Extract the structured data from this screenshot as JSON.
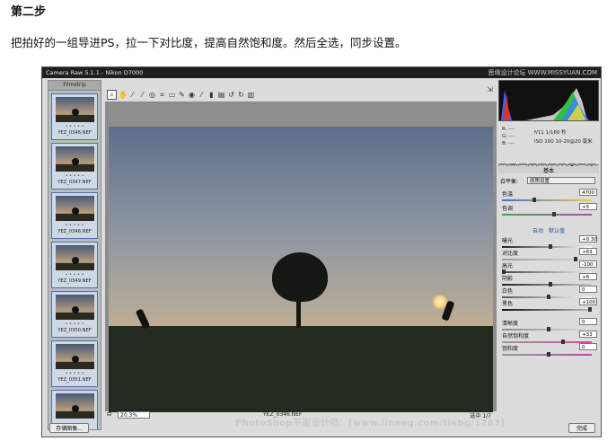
{
  "heading": "第二步",
  "intro": "把拍好的一组导进PS，拉一下对比度，提高自然饱和度。然后全选，同步设置。",
  "app": {
    "title": "Camera Raw 5.1.1 - Nikon D7000",
    "top_watermark": "思缘设计论坛 WWW.MISSYUAN.COM",
    "filmstrip_label": "Filmstrip",
    "thumb_dots": "• • • • •",
    "thumbnails": [
      "YEZ_0346.NEF",
      "YEZ_0347.NEF",
      "YEZ_0348.NEF",
      "YEZ_0349.NEF",
      "YEZ_0350.NEF",
      "YEZ_0351.NEF"
    ],
    "zoom": "20.3%",
    "current_file": "YEZ_0346.NEF",
    "pager": "选中 1/7",
    "info": {
      "r": "R: ---",
      "g": "G: ---",
      "b": "B: ---",
      "exposure": "f/11   1/160 秒",
      "iso": "ISO 100   10-20@20 毫米"
    },
    "panel_title": "基本",
    "wb_label": "白平衡:",
    "wb_value": "原照设置",
    "auto": "自动",
    "default": "默认值",
    "sliders": [
      {
        "label": "色温",
        "value": "4700"
      },
      {
        "label": "色调",
        "value": "+5"
      },
      {
        "label": "曝光",
        "value": "+0.30"
      },
      {
        "label": "对比度",
        "value": "+63"
      },
      {
        "label": "高光",
        "value": "-100"
      },
      {
        "label": "阴影",
        "value": "+6"
      },
      {
        "label": "白色",
        "value": "0"
      },
      {
        "label": "黑色",
        "value": "+100"
      },
      {
        "label": "清晰度",
        "value": "0"
      },
      {
        "label": "自然饱和度",
        "value": "+33"
      },
      {
        "label": "饱和度",
        "value": "0"
      }
    ],
    "save_button": "存储图像...",
    "done_button": "完成",
    "footer_watermark": "PhotoShop平面设计吧：[www.lineeg.com/tiebg/1783]"
  }
}
